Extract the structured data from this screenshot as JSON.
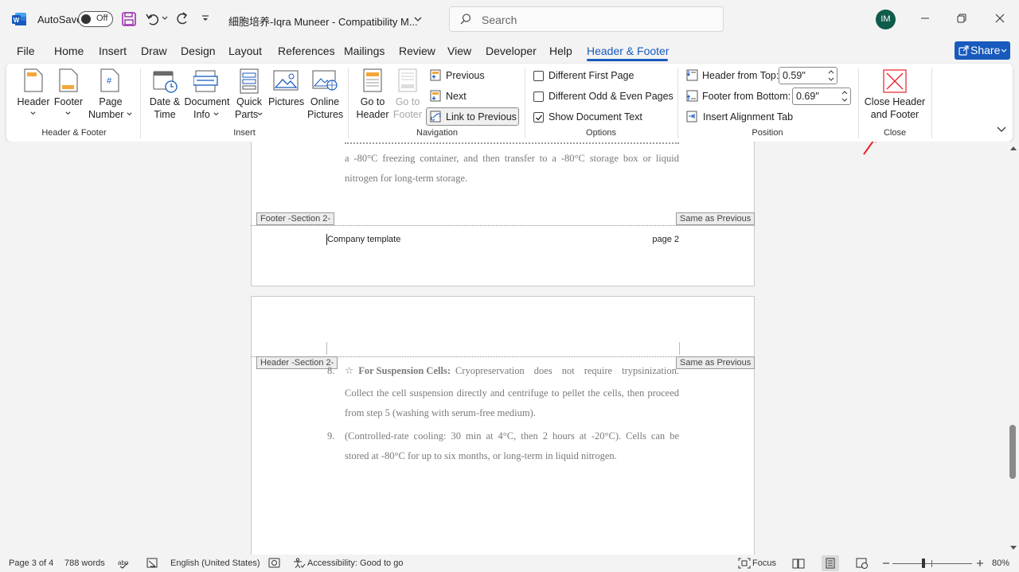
{
  "titlebar": {
    "autosave_label": "AutoSave",
    "autosave_state": "Off",
    "document_title": "細胞培养-Iqra Muneer  -  Compatibility M...",
    "search_placeholder": "Search",
    "avatar_initials": "IM"
  },
  "menu": {
    "tabs": [
      "File",
      "Home",
      "Insert",
      "Draw",
      "Design",
      "Layout",
      "References",
      "Mailings",
      "Review",
      "View",
      "Developer",
      "Help",
      "Header & Footer"
    ],
    "share_label": "Share"
  },
  "ribbon": {
    "header_footer": {
      "header": "Header",
      "footer": "Footer",
      "page_number_1": "Page",
      "page_number_2": "Number",
      "group": "Header & Footer"
    },
    "insert": {
      "date_time_1": "Date &",
      "date_time_2": "Time",
      "document_info_1": "Document",
      "document_info_2": "Info",
      "quick_parts_1": "Quick",
      "quick_parts_2": "Parts",
      "pictures": "Pictures",
      "online_pictures_1": "Online",
      "online_pictures_2": "Pictures",
      "group": "Insert"
    },
    "navigation": {
      "go_to_header_1": "Go to",
      "go_to_header_2": "Header",
      "go_to_footer_1": "Go to",
      "go_to_footer_2": "Footer",
      "previous": "Previous",
      "next": "Next",
      "link_to_previous": "Link to Previous",
      "group": "Navigation"
    },
    "options": {
      "different_first_page": "Different First Page",
      "different_odd_even": "Different Odd & Even Pages",
      "show_document_text": "Show Document Text",
      "group": "Options"
    },
    "position": {
      "header_from_top_label": "Header from Top:",
      "header_from_top_value": "0.59\"",
      "footer_from_bottom_label": "Footer from Bottom:",
      "footer_from_bottom_value": "0.69\"",
      "insert_alignment_tab": "Insert Alignment Tab",
      "group": "Position"
    },
    "close": {
      "close_1": "Close Header",
      "close_2": "and Footer",
      "group": "Close"
    }
  },
  "document": {
    "page1": {
      "para_line_1": "a -80°C freezing container, and then transfer to a -80°C storage box or liquid",
      "para_line_2": "nitrogen for long-term storage.",
      "footer_tag": "Footer -Section 2-",
      "same_as_previous": "Same as Previous",
      "footer_left": "Company template",
      "footer_right": "page 2"
    },
    "page2": {
      "header_tag": "Header -Section 2-",
      "same_as_previous": "Same as Previous",
      "item8_number": "8.",
      "item8_star": "☆",
      "item8_bold": "For Suspension Cells:",
      "item8_line_1_rest": "Cryopreservation does not require trypsinization.",
      "item8_line_2": "Collect the cell suspension directly and centrifuge to pellet the cells, then proceed",
      "item8_line_3": "from step 5 (washing with serum-free medium).",
      "item9_number": "9.",
      "item9_line_1": "(Controlled-rate cooling: 30 min at 4°C, then 2 hours at -20°C). Cells can be",
      "item9_line_2": "stored at -80°C for up to six months, or long-term in liquid nitrogen."
    }
  },
  "statusbar": {
    "page": "Page 3 of 4",
    "words": "788 words",
    "language": "English (United States)",
    "accessibility": "Accessibility: Good to go",
    "focus": "Focus",
    "zoom": "80%",
    "zoom_level": 0.8
  },
  "colors": {
    "accent": "#185abd",
    "arrow": "#e8202a",
    "word_blue": "#185abd",
    "save_purple": "#9b2fae"
  }
}
